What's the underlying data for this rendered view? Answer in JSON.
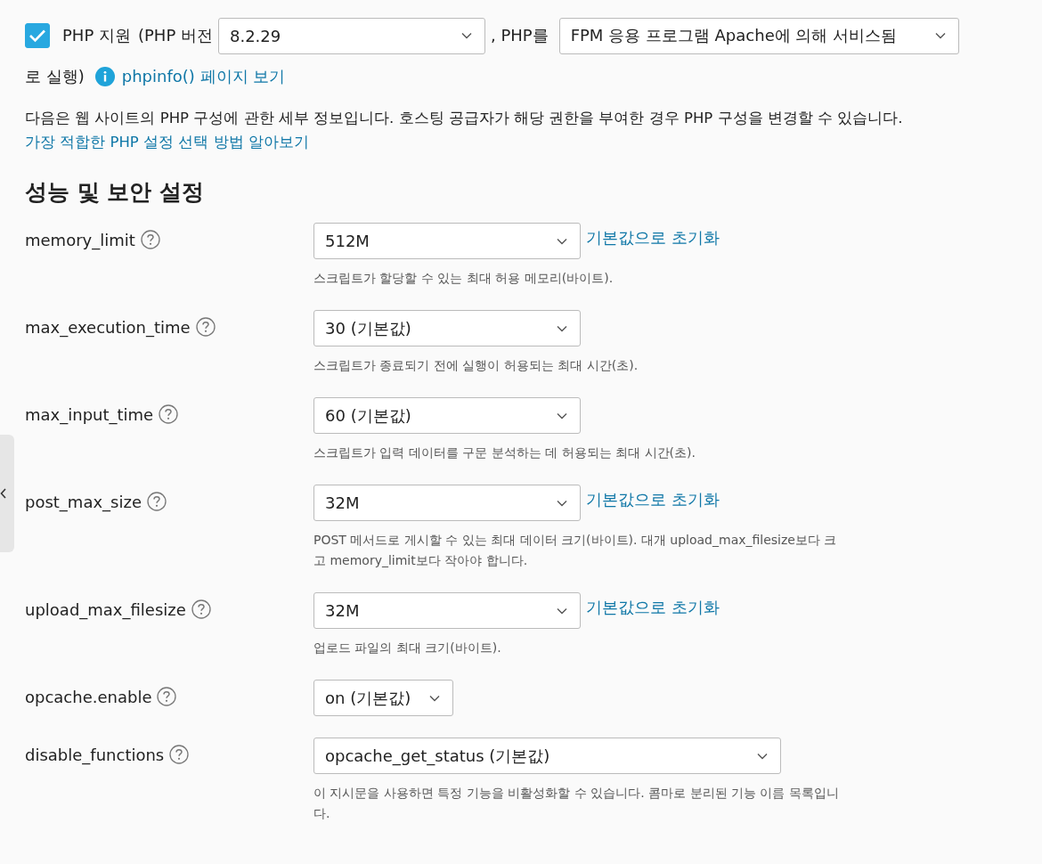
{
  "php_support": {
    "checked": true,
    "label": "PHP 지원",
    "version_label": "(PHP 버전",
    "version": "8.2.29",
    "handler_label": ", PHP를",
    "handler": "FPM 응용 프로그램 Apache에 의해 서비스됨",
    "run_label": "로 실행)",
    "phpinfo_link": "phpinfo() 페이지 보기"
  },
  "intro": {
    "text": "다음은 웹 사이트의 PHP 구성에 관한 세부 정보입니다. 호스팅 공급자가 해당 권한을 부여한 경우 PHP 구성을 변경할 수 있습니다.",
    "link": "가장 적합한 PHP 설정 선택 방법 알아보기"
  },
  "section_title": "성능 및 보안 설정",
  "settings": [
    {
      "name": "memory_limit",
      "value": "512M",
      "kind": "normal",
      "reset": "기본값으로 초기화",
      "description": "스크립트가 할당할 수 있는 최대 허용 메모리(바이트)."
    },
    {
      "name": "max_execution_time",
      "value": "30 (기본값)",
      "kind": "normal",
      "description": "스크립트가 종료되기 전에 실행이 허용되는 최대 시간(초)."
    },
    {
      "name": "max_input_time",
      "value": "60 (기본값)",
      "kind": "normal",
      "description": "스크립트가 입력 데이터를 구문 분석하는 데 허용되는 최대 시간(초)."
    },
    {
      "name": "post_max_size",
      "value": "32M",
      "kind": "normal",
      "reset": "기본값으로 초기화",
      "description": "POST 메서드로 게시할 수 있는 최대 데이터 크기(바이트). 대개 upload_max_filesize보다 크고 memory_limit보다 작아야 합니다."
    },
    {
      "name": "upload_max_filesize",
      "value": "32M",
      "kind": "normal",
      "reset": "기본값으로 초기화",
      "description": "업로드 파일의 최대 크기(바이트)."
    },
    {
      "name": "opcache.enable",
      "value": "on (기본값)",
      "kind": "narrow"
    },
    {
      "name": "disable_functions",
      "value": "opcache_get_status (기본값)",
      "kind": "wide",
      "description": "이 지시문을 사용하면 특정 기능을 비활성화할 수 있습니다. 콤마로 분리된 기능 이름 목록입니다."
    }
  ]
}
